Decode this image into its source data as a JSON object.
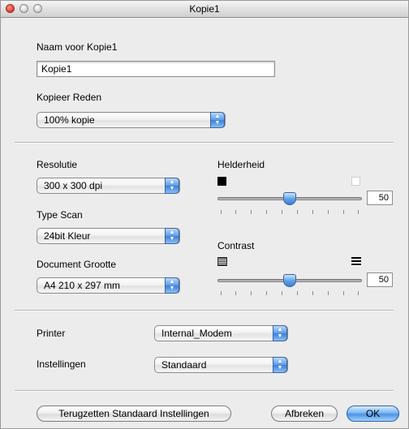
{
  "window": {
    "title": "Kopie1"
  },
  "name_section": {
    "label": "Naam voor Kopie1",
    "value": "Kopie1"
  },
  "reason_section": {
    "label": "Kopieer Reden",
    "selected": "100% kopie"
  },
  "resolution": {
    "label": "Resolutie",
    "selected": "300 x 300 dpi"
  },
  "scan_type": {
    "label": "Type Scan",
    "selected": "24bit Kleur"
  },
  "document_size": {
    "label": "Document Grootte",
    "selected": "A4 210 x 297 mm"
  },
  "brightness": {
    "label": "Helderheid",
    "value": "50",
    "level": 0.5
  },
  "contrast": {
    "label": "Contrast",
    "value": "50",
    "level": 0.5
  },
  "printer": {
    "label": "Printer",
    "selected": "Internal_Modem"
  },
  "settings": {
    "label": "Instellingen",
    "selected": "Standaard"
  },
  "buttons": {
    "reset": "Terugzetten Standaard Instellingen",
    "cancel": "Afbreken",
    "ok": "OK"
  }
}
